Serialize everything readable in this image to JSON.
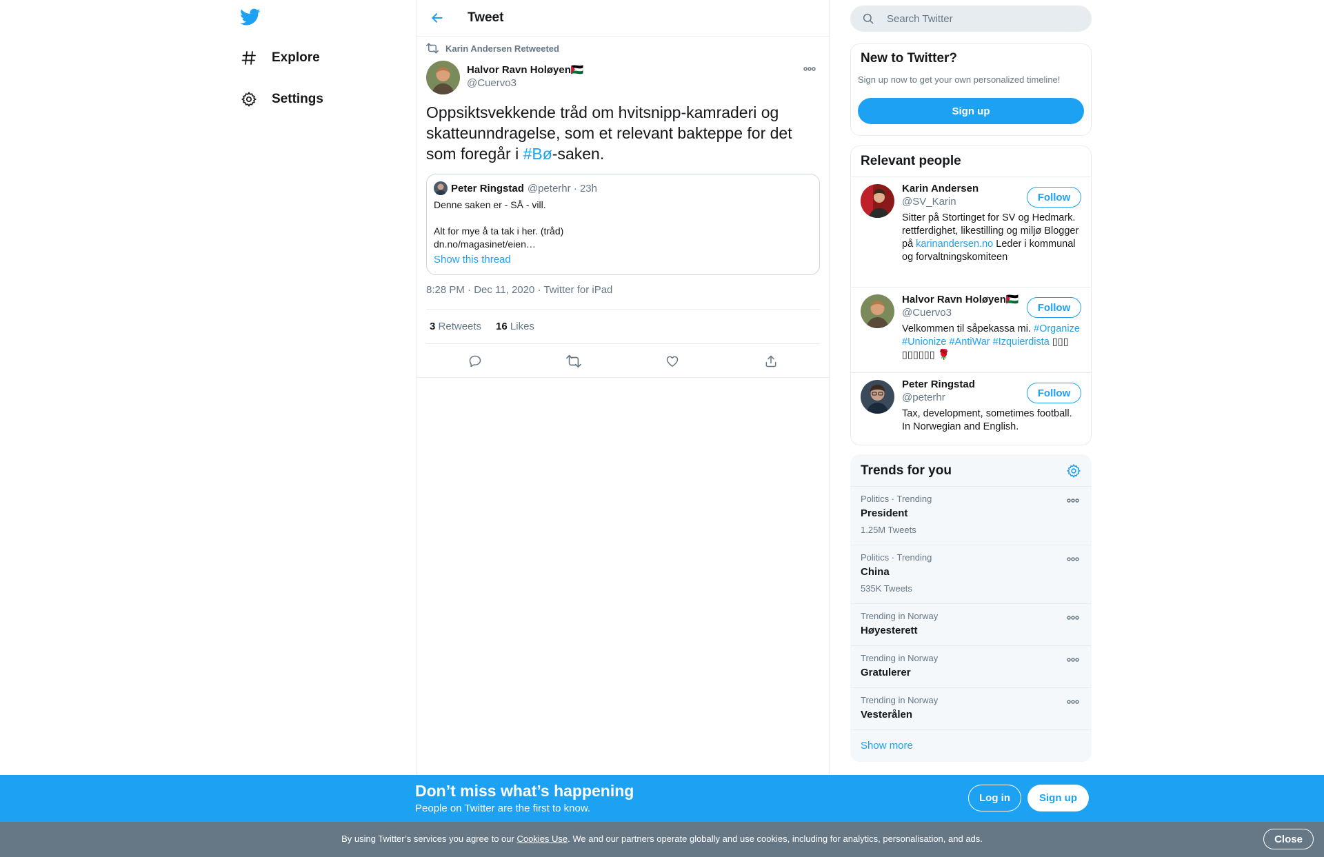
{
  "colors": {
    "accent": "#1da1f2",
    "text": "#14171a",
    "muted": "#657786",
    "border": "#e6ecf0",
    "cookie_bg": "#667786"
  },
  "nav": {
    "logo_icon": "twitter-bird-icon",
    "items": [
      {
        "label": "Explore",
        "icon": "hash-icon"
      },
      {
        "label": "Settings",
        "icon": "gear-icon"
      }
    ]
  },
  "header": {
    "title": "Tweet",
    "back_icon": "back-arrow-icon"
  },
  "tweet": {
    "retweeted_by": "Karin Andersen Retweeted",
    "author_name": "Halvor Ravn Holøyen",
    "author_flag": "🇵🇸",
    "author_handle": "@Cuervo3",
    "text_before": "Oppsiktsvekkende tråd om hvitsnipp-kamraderi og skatteunndragelse, som et relevant bakteppe for det som foregår i ",
    "hashtag": "#Bø",
    "text_after": "-saken.",
    "quote": {
      "name": "Peter Ringstad",
      "meta": "@peterhr · 23h",
      "body": "Denne saken er - SÅ - vill.\n\nAlt for mye å ta tak i her. (tråd)\n dn.no/magasinet/eien…",
      "show_thread": "Show this thread"
    },
    "timestamp": "8:28 PM · Dec 11, 2020 · Twitter for iPad",
    "retweets_count": "3",
    "retweets_label": "Retweets",
    "likes_count": "16",
    "likes_label": "Likes"
  },
  "search": {
    "placeholder": "Search Twitter"
  },
  "new_to_twitter": {
    "title": "New to Twitter?",
    "subtitle": "Sign up now to get your own personalized timeline!",
    "button": "Sign up"
  },
  "relevant_people": {
    "title": "Relevant people",
    "follow_label": "Follow",
    "people": [
      {
        "name": "Karin Andersen",
        "flag": "",
        "handle": "@SV_Karin",
        "bio_before": "Sitter på Stortinget for SV og Hedmark. rettferdighet, likestilling og miljø Blogger på ",
        "bio_link": "karinandersen.no",
        "bio_after": " Leder i kommunal og forvaltningskomiteen"
      },
      {
        "name": "Halvor Ravn Holøyen",
        "flag": "🇵🇸",
        "handle": "@Cuervo3",
        "bio_before": "Velkommen til såpekassa mi. ",
        "bio_link": "#Organize #Unionize #AntiWar #Izquierdista",
        "bio_after": " ▯▯▯ ▯▯▯▯▯▯ 🌹"
      },
      {
        "name": "Peter Ringstad",
        "flag": "",
        "handle": "@peterhr",
        "bio_before": "Tax, development, sometimes football. In Norwegian and English.",
        "bio_link": "",
        "bio_after": ""
      }
    ]
  },
  "trends": {
    "title": "Trends for you",
    "items": [
      {
        "meta": "Politics · Trending",
        "name": "President",
        "count": "1.25M Tweets"
      },
      {
        "meta": "Politics · Trending",
        "name": "China",
        "count": "535K Tweets"
      },
      {
        "meta": "Trending in Norway",
        "name": "Høyesterett",
        "count": ""
      },
      {
        "meta": "Trending in Norway",
        "name": "Gratulerer",
        "count": ""
      },
      {
        "meta": "Trending in Norway",
        "name": "Vesterålen",
        "count": ""
      }
    ],
    "show_more": "Show more"
  },
  "bottom_bar": {
    "title": "Don’t miss what’s happening",
    "subtitle": "People on Twitter are the first to know.",
    "login": "Log in",
    "signup": "Sign up"
  },
  "cookie": {
    "text_before": "By using Twitter’s services you agree to our ",
    "link": "Cookies Use",
    "text_after": ". We and our partners operate globally and use cookies, including for analytics, personalisation, and ads.",
    "close": "Close"
  }
}
